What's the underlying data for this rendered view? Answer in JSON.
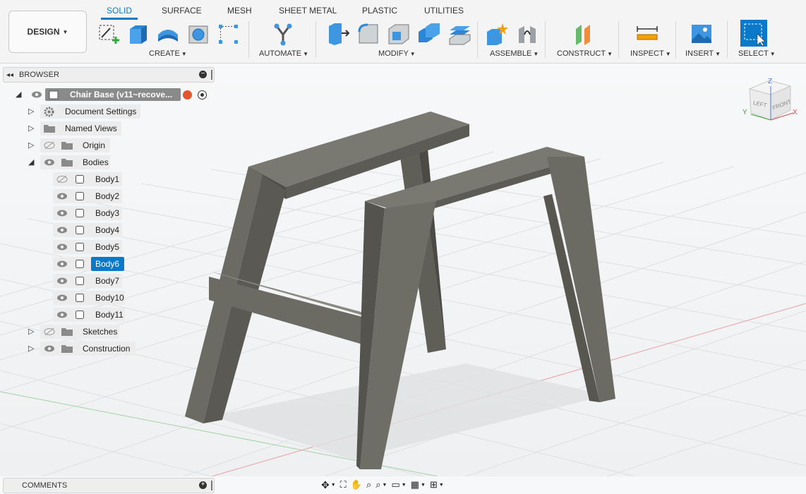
{
  "toolbar": {
    "design_label": "DESIGN",
    "tabs": [
      "SOLID",
      "SURFACE",
      "MESH",
      "SHEET METAL",
      "PLASTIC",
      "UTILITIES"
    ],
    "active_tab": "SOLID",
    "groups": {
      "create": "CREATE",
      "automate": "AUTOMATE",
      "modify": "MODIFY",
      "assemble": "ASSEMBLE",
      "construct": "CONSTRUCT",
      "inspect": "INSPECT",
      "insert": "INSERT",
      "select": "SELECT"
    }
  },
  "browser": {
    "title": "BROWSER",
    "document_name": "Chair Base (v11~recove...",
    "items": {
      "document_settings": "Document Settings",
      "named_views": "Named Views",
      "origin": "Origin",
      "bodies": "Bodies",
      "sketches": "Sketches",
      "construction": "Construction"
    },
    "bodies": [
      "Body1",
      "Body2",
      "Body3",
      "Body4",
      "Body5",
      "Body6",
      "Body7",
      "Body10",
      "Body11"
    ],
    "selected_body": "Body6"
  },
  "viewcube": {
    "top": "Z",
    "left_face": "LEFT",
    "front_face": "FRONT",
    "x_axis": "X",
    "y_axis": "Y"
  },
  "comments": {
    "title": "COMMENTS"
  },
  "colors": {
    "accent": "#0b79c9",
    "model": "#6f6e66"
  }
}
